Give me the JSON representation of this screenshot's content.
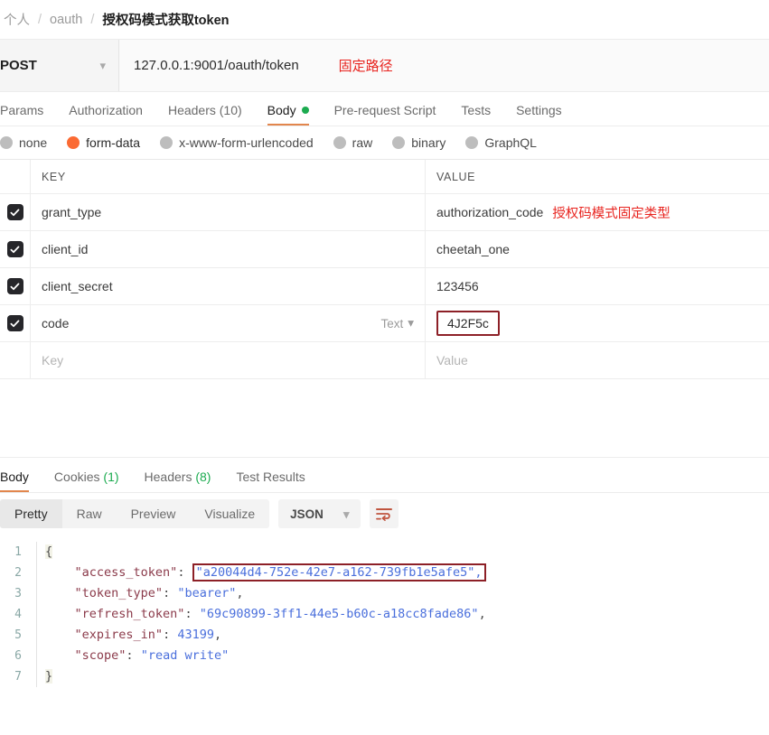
{
  "breadcrumb": {
    "items": [
      {
        "label": "个人",
        "current": false
      },
      {
        "label": "oauth",
        "current": false
      },
      {
        "label": "授权码模式获取token",
        "current": true
      }
    ],
    "separator": "/"
  },
  "request": {
    "method": "POST",
    "method_caret": "chevron-down-icon",
    "url": "127.0.0.1:9001/oauth/token",
    "url_annotation": "固定路径",
    "tabs": [
      {
        "label": "Params",
        "active": false,
        "dot": false
      },
      {
        "label": "Authorization",
        "active": false,
        "dot": false
      },
      {
        "label": "Headers (10)",
        "active": false,
        "dot": false
      },
      {
        "label": "Body",
        "active": true,
        "dot": true
      },
      {
        "label": "Pre-request Script",
        "active": false,
        "dot": false
      },
      {
        "label": "Tests",
        "active": false,
        "dot": false
      },
      {
        "label": "Settings",
        "active": false,
        "dot": false
      }
    ],
    "body_types": [
      {
        "label": "none",
        "selected": false
      },
      {
        "label": "form-data",
        "selected": true
      },
      {
        "label": "x-www-form-urlencoded",
        "selected": false
      },
      {
        "label": "raw",
        "selected": false
      },
      {
        "label": "binary",
        "selected": false
      },
      {
        "label": "GraphQL",
        "selected": false
      }
    ],
    "table": {
      "headers": {
        "key": "KEY",
        "value": "VALUE"
      },
      "rows": [
        {
          "checked": true,
          "key": "grant_type",
          "type": "",
          "value": "authorization_code",
          "value_annotation": "授权码模式固定类型",
          "value_boxed": false
        },
        {
          "checked": true,
          "key": "client_id",
          "type": "",
          "value": "cheetah_one",
          "value_annotation": "",
          "value_boxed": false
        },
        {
          "checked": true,
          "key": "client_secret",
          "type": "",
          "value": "123456",
          "value_annotation": "",
          "value_boxed": false
        },
        {
          "checked": true,
          "key": "code",
          "type": "Text",
          "value": "4J2F5c",
          "value_annotation": "",
          "value_boxed": true
        }
      ],
      "empty_row": {
        "key_placeholder": "Key",
        "value_placeholder": "Value"
      }
    }
  },
  "response": {
    "tabs": [
      {
        "label": "Body",
        "active": true,
        "count": ""
      },
      {
        "label": "Cookies",
        "active": false,
        "count": "(1)"
      },
      {
        "label": "Headers",
        "active": false,
        "count": "(8)"
      },
      {
        "label": "Test Results",
        "active": false,
        "count": ""
      }
    ],
    "views": [
      {
        "label": "Pretty",
        "active": true
      },
      {
        "label": "Raw",
        "active": false
      },
      {
        "label": "Preview",
        "active": false
      },
      {
        "label": "Visualize",
        "active": false
      }
    ],
    "format": "JSON",
    "format_caret": "chevron-down-icon",
    "wrap_icon": "word-wrap-icon",
    "json_lines": [
      {
        "n": "1",
        "tokens": [
          {
            "t": "{",
            "c": "brace"
          }
        ]
      },
      {
        "n": "2",
        "tokens": [
          {
            "t": "    ",
            "c": "p"
          },
          {
            "t": "\"access_token\"",
            "c": "k"
          },
          {
            "t": ": ",
            "c": "p"
          },
          {
            "t": "\"a20044d4-752e-42e7-a162-739fb1e5afe5\",",
            "c": "s",
            "boxed": true
          }
        ]
      },
      {
        "n": "3",
        "tokens": [
          {
            "t": "    ",
            "c": "p"
          },
          {
            "t": "\"token_type\"",
            "c": "k"
          },
          {
            "t": ": ",
            "c": "p"
          },
          {
            "t": "\"bearer\"",
            "c": "s"
          },
          {
            "t": ",",
            "c": "p"
          }
        ]
      },
      {
        "n": "4",
        "tokens": [
          {
            "t": "    ",
            "c": "p"
          },
          {
            "t": "\"refresh_token\"",
            "c": "k"
          },
          {
            "t": ": ",
            "c": "p"
          },
          {
            "t": "\"69c90899-3ff1-44e5-b60c-a18cc8fade86\"",
            "c": "s"
          },
          {
            "t": ",",
            "c": "p"
          }
        ]
      },
      {
        "n": "5",
        "tokens": [
          {
            "t": "    ",
            "c": "p"
          },
          {
            "t": "\"expires_in\"",
            "c": "k"
          },
          {
            "t": ": ",
            "c": "p"
          },
          {
            "t": "43199",
            "c": "n"
          },
          {
            "t": ",",
            "c": "p"
          }
        ]
      },
      {
        "n": "6",
        "tokens": [
          {
            "t": "    ",
            "c": "p"
          },
          {
            "t": "\"scope\"",
            "c": "k"
          },
          {
            "t": ": ",
            "c": "p"
          },
          {
            "t": "\"read write\"",
            "c": "s"
          }
        ]
      },
      {
        "n": "7",
        "tokens": [
          {
            "t": "}",
            "c": "brace"
          }
        ]
      }
    ]
  },
  "colors": {
    "accent_orange": "#e2864d",
    "radio_selected": "#fb6a33",
    "green_dot": "#1cab50",
    "annotation_red": "#e8241f",
    "highlight_box": "#8d2027"
  }
}
